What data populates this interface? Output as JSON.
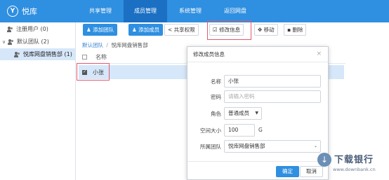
{
  "app": {
    "logo_text": "悦库"
  },
  "nav": {
    "tabs": [
      {
        "label": "共享管理"
      },
      {
        "label": "成员管理"
      },
      {
        "label": "系统管理"
      },
      {
        "label": "返回网盘"
      }
    ],
    "active_index": 1
  },
  "sidebar": {
    "items": [
      {
        "label": "注册用户 (0)"
      },
      {
        "label": "默认团队 (2)"
      },
      {
        "label": "悦库网盘销售部 (1)"
      }
    ]
  },
  "toolbar": {
    "add_team": "添加团队",
    "add_member": "添加成员",
    "share_permission": "共享权限",
    "edit_info": "修改信息",
    "move": "移动",
    "delete": "删除"
  },
  "breadcrumb": {
    "root": "默认团队",
    "separator": "/",
    "current": "悦库网盘销售部"
  },
  "table": {
    "header_name": "名称",
    "rows": [
      {
        "name": "小张",
        "checked": true
      }
    ]
  },
  "modal": {
    "title": "修改成员信息",
    "close_label": "×",
    "fields": {
      "name_label": "名称",
      "name_value": "小张",
      "password_label": "密码",
      "password_placeholder": "请输入密码",
      "role_label": "角色",
      "role_value": "普通成员",
      "space_label": "空间大小",
      "space_value": "100",
      "space_unit": "G",
      "team_label": "所属团队",
      "team_value": "悦库网盘销售部"
    },
    "confirm_label": "确定",
    "cancel_label": "取消"
  },
  "watermark": {
    "title": "下载银行",
    "url": "www.downbank.cn"
  },
  "colors": {
    "primary": "#2f8fe0",
    "nav_active": "#1b70c4",
    "highlight": "#e15a6e",
    "selected_row": "#d6e7fa"
  }
}
